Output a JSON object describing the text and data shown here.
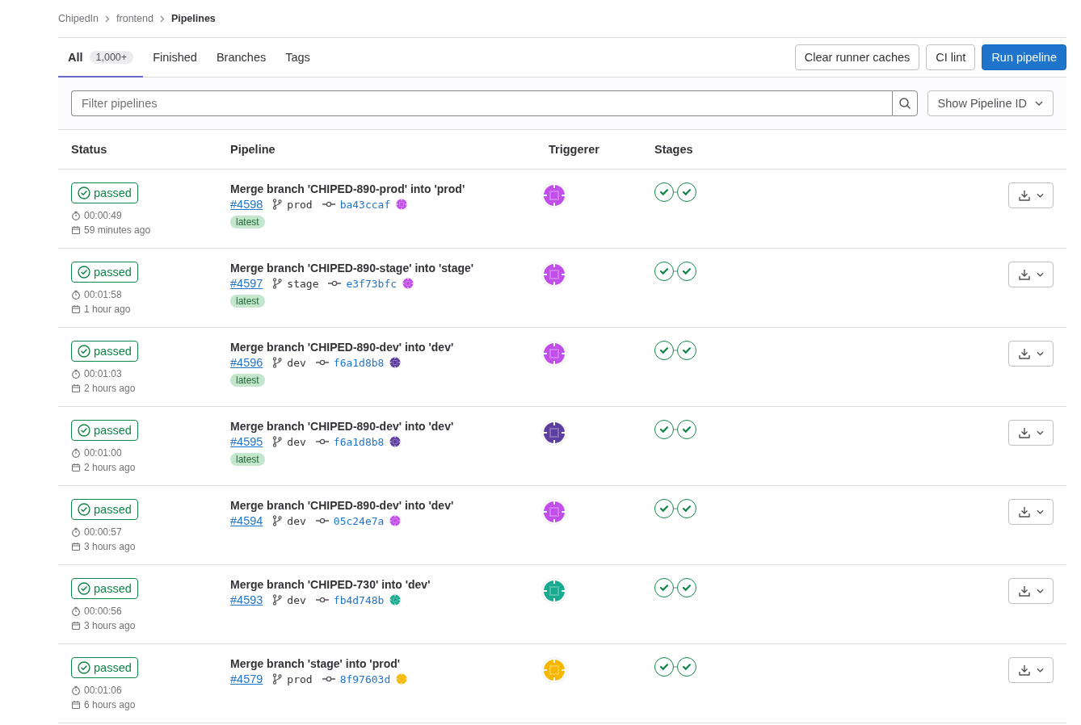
{
  "breadcrumbs": [
    {
      "label": "ChipedIn",
      "current": false
    },
    {
      "label": "frontend",
      "current": false
    },
    {
      "label": "Pipelines",
      "current": true
    }
  ],
  "tabs": [
    {
      "label": "All",
      "count": "1,000+",
      "selected": true
    },
    {
      "label": "Finished",
      "selected": false
    },
    {
      "label": "Branches",
      "selected": false
    },
    {
      "label": "Tags",
      "selected": false
    }
  ],
  "actions": [
    {
      "label": "Clear runner caches",
      "kind": "secondary"
    },
    {
      "label": "CI lint",
      "kind": "secondary"
    },
    {
      "label": "Run pipeline",
      "kind": "primary"
    }
  ],
  "filter": {
    "placeholder": "Filter pipelines",
    "dropdown": "Show Pipeline ID"
  },
  "table": {
    "columns": [
      "Status",
      "Pipeline",
      "Triggerer",
      "Stages"
    ],
    "rows": [
      {
        "status": "passed",
        "duration": "00:00:49",
        "finished": "59 minutes ago",
        "title": "Merge branch 'CHIPED-890-prod' into 'prod'",
        "id": "#4598",
        "branch": "prod",
        "commit": "ba43ccaf",
        "badge": "latest",
        "triggerer": {
          "color": "#c14ee8"
        },
        "commit_author": {
          "color": "#c14ee8"
        },
        "stages": [
          {
            "passed": true
          },
          {
            "passed": true
          }
        ]
      },
      {
        "status": "passed",
        "duration": "00:01:58",
        "finished": "1 hour ago",
        "title": "Merge branch 'CHIPED-890-stage' into 'stage'",
        "id": "#4597",
        "branch": "stage",
        "commit": "e3f73bfc",
        "badge": "latest",
        "triggerer": {
          "color": "#c14ee8"
        },
        "commit_author": {
          "color": "#c14ee8"
        },
        "stages": [
          {
            "passed": true
          },
          {
            "passed": true
          }
        ]
      },
      {
        "status": "passed",
        "duration": "00:01:03",
        "finished": "2 hours ago",
        "title": "Merge branch 'CHIPED-890-dev' into 'dev'",
        "id": "#4596",
        "branch": "dev",
        "commit": "f6a1d8b8",
        "badge": "latest",
        "triggerer": {
          "color": "#c14ee8"
        },
        "commit_author": {
          "color": "#5c3f9e"
        },
        "stages": [
          {
            "passed": true
          },
          {
            "passed": true
          }
        ]
      },
      {
        "status": "passed",
        "duration": "00:01:00",
        "finished": "2 hours ago",
        "title": "Merge branch 'CHIPED-890-dev' into 'dev'",
        "id": "#4595",
        "branch": "dev",
        "commit": "f6a1d8b8",
        "badge": "latest",
        "triggerer": {
          "color": "#5c3f9e"
        },
        "commit_author": {
          "color": "#5c3f9e"
        },
        "stages": [
          {
            "passed": true
          },
          {
            "passed": true
          }
        ]
      },
      {
        "status": "passed",
        "duration": "00:00:57",
        "finished": "3 hours ago",
        "title": "Merge branch 'CHIPED-890-dev' into 'dev'",
        "id": "#4594",
        "branch": "dev",
        "commit": "05c24e7a",
        "triggerer": {
          "color": "#c14ee8"
        },
        "commit_author": {
          "color": "#c14ee8"
        },
        "stages": [
          {
            "passed": true
          },
          {
            "passed": true
          }
        ]
      },
      {
        "status": "passed",
        "duration": "00:00:56",
        "finished": "3 hours ago",
        "title": "Merge branch 'CHIPED-730' into 'dev'",
        "id": "#4593",
        "branch": "dev",
        "commit": "fb4d748b",
        "triggerer": {
          "color": "#1aaa8f"
        },
        "commit_author": {
          "color": "#1aaa8f"
        },
        "stages": [
          {
            "passed": true
          },
          {
            "passed": true
          }
        ]
      },
      {
        "status": "passed",
        "duration": "00:01:06",
        "finished": "6 hours ago",
        "title": "Merge branch 'stage' into 'prod'",
        "id": "#4579",
        "branch": "prod",
        "commit": "8f97603d",
        "triggerer": {
          "color": "#f5b700"
        },
        "commit_author": {
          "color": "#f5b700"
        },
        "stages": [
          {
            "passed": true
          },
          {
            "passed": true
          }
        ]
      }
    ]
  }
}
